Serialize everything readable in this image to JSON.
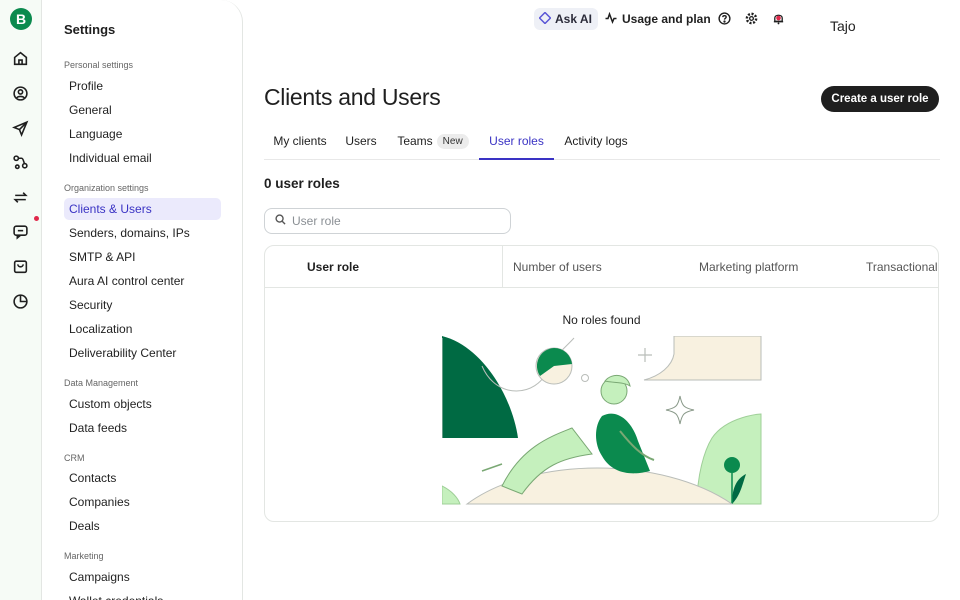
{
  "rail": {
    "logo": "B",
    "icons": [
      "home-icon",
      "contacts-icon",
      "send-icon",
      "automation-icon",
      "transactional-icon",
      "conversations-icon",
      "ecommerce-icon",
      "reports-icon"
    ]
  },
  "sidebar": {
    "title": "Settings",
    "groups": {
      "personal": "Personal settings",
      "organization": "Organization settings",
      "data": "Data Management",
      "crm": "CRM",
      "marketing": "Marketing"
    },
    "items": {
      "profile": "Profile",
      "general": "General",
      "language": "Language",
      "individual_email": "Individual email",
      "clients_users": "Clients & Users",
      "senders": "Senders, domains, IPs",
      "smtp": "SMTP & API",
      "aura": "Aura AI control center",
      "security": "Security",
      "localization": "Localization",
      "deliverability": "Deliverability Center",
      "custom_objects": "Custom objects",
      "data_feeds": "Data feeds",
      "contacts": "Contacts",
      "companies": "Companies",
      "deals": "Deals",
      "campaigns": "Campaigns",
      "wallet": "Wallet credentials"
    }
  },
  "topbar": {
    "ask_ai": "Ask AI",
    "usage": "Usage and plan",
    "user_name": "Tajo"
  },
  "main": {
    "title": "Clients and Users",
    "create_button": "Create a user role",
    "tabs": {
      "my_clients": "My clients",
      "users": "Users",
      "teams": "Teams",
      "teams_badge": "New",
      "user_roles": "User roles",
      "activity_logs": "Activity logs"
    },
    "roles_count": "0 user roles",
    "search_placeholder": "User role",
    "table": {
      "columns": {
        "role": "User role",
        "users": "Number of users",
        "marketing": "Marketing platform",
        "transactional": "Transactional"
      },
      "empty_text": "No roles found"
    }
  },
  "colors": {
    "accent": "#3a33c4",
    "brand_green": "#0b8a4e",
    "dark_green": "#006a43",
    "light_green": "#c5f0bd",
    "cream": "#f8f1e0"
  }
}
